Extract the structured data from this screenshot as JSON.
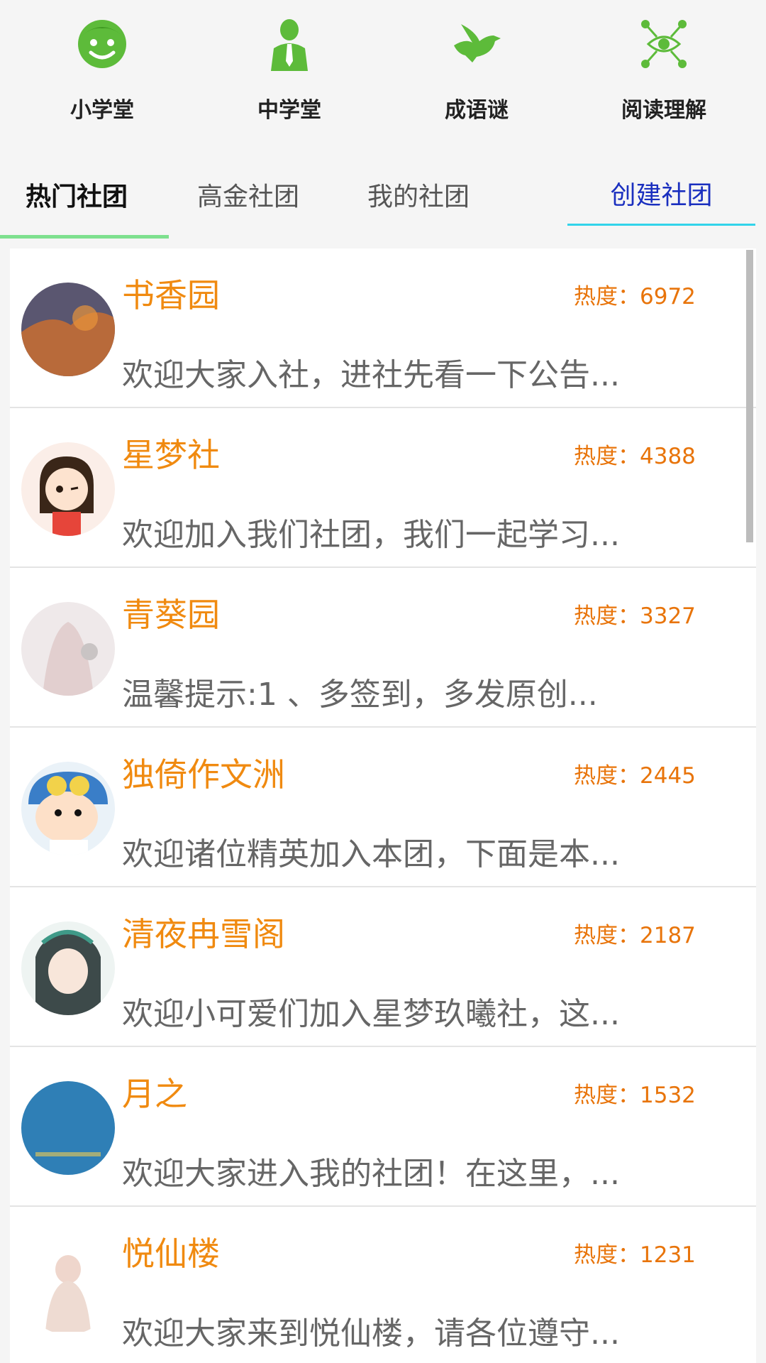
{
  "categories": [
    {
      "label": "小学堂",
      "icon": "smiley-face-icon"
    },
    {
      "label": "中学堂",
      "icon": "person-tie-icon"
    },
    {
      "label": "成语谜",
      "icon": "bird-icon"
    },
    {
      "label": "阅读理解",
      "icon": "eye-network-icon"
    }
  ],
  "tabs": [
    {
      "label": "热门社团",
      "active": true
    },
    {
      "label": "高金社团",
      "active": false
    },
    {
      "label": "我的社团",
      "active": false
    }
  ],
  "create_label": "创建社团",
  "colors": {
    "accent_green": "#5dbb3a",
    "title_orange": "#f08a10",
    "heat_orange": "#e8740a",
    "create_blue": "#1a2fbf"
  },
  "clubs": [
    {
      "name": "书香园",
      "heat": "热度：6972",
      "desc": "欢迎大家入社，进社先看一下公告..."
    },
    {
      "name": "星梦社",
      "heat": "热度：4388",
      "desc": "欢迎加入我们社团，我们一起学习..."
    },
    {
      "name": "青葵园",
      "heat": "热度：3327",
      "desc": "温馨提示:1 、多签到，多发原创..."
    },
    {
      "name": "独倚作文洲",
      "heat": "热度：2445",
      "desc": "欢迎诸位精英加入本团，下面是本..."
    },
    {
      "name": "清夜冉雪阁",
      "heat": "热度：2187",
      "desc": "欢迎小可爱们加入星梦玖曦社，这..."
    },
    {
      "name": "月之",
      "heat": "热度：1532",
      "desc": "欢迎大家进入我的社团！在这里，..."
    },
    {
      "name": "悦仙楼",
      "heat": "热度：1231",
      "desc": "欢迎大家来到悦仙楼，请各位遵守..."
    }
  ]
}
